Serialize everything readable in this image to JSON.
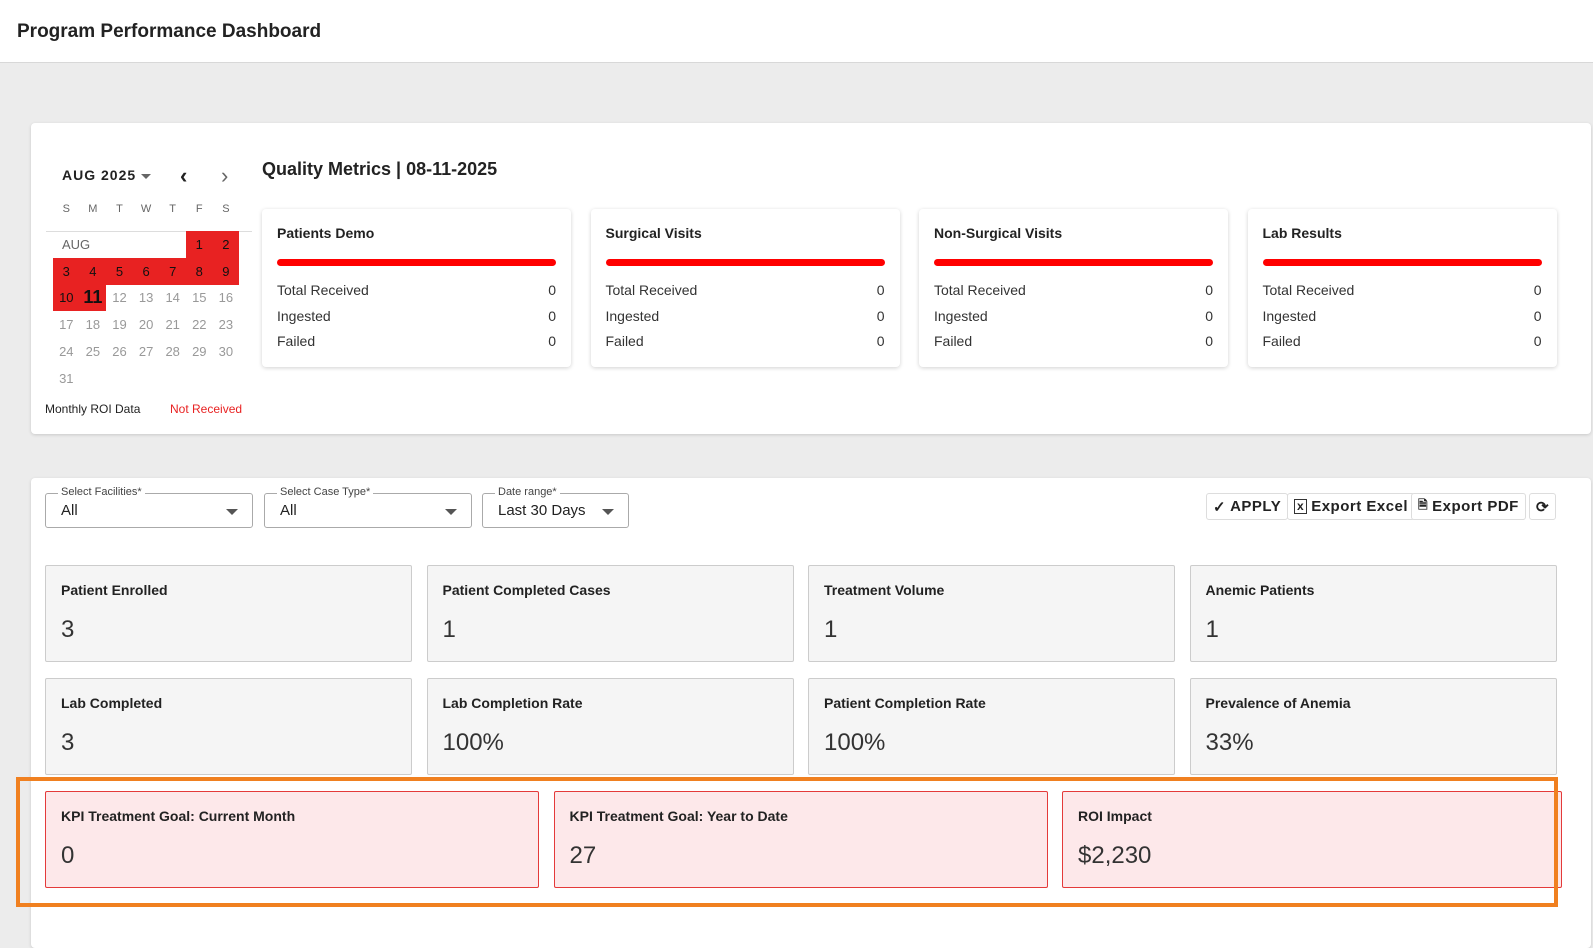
{
  "header": {
    "title": "Program Performance Dashboard"
  },
  "calendar": {
    "month_label": "AUG 2025",
    "weekdays": [
      "S",
      "M",
      "T",
      "W",
      "T",
      "F",
      "S"
    ],
    "section_label": "AUG",
    "days": [
      "1",
      "2",
      "3",
      "4",
      "5",
      "6",
      "7",
      "8",
      "9",
      "10",
      "11",
      "12",
      "13",
      "14",
      "15",
      "16",
      "17",
      "18",
      "19",
      "20",
      "21",
      "22",
      "23",
      "24",
      "25",
      "26",
      "27",
      "28",
      "29",
      "30",
      "31"
    ],
    "highlighted_through": 11,
    "today": "11",
    "legend_label": "Monthly ROI Data",
    "legend_status": "Not Received",
    "highlight_color": "#e82222"
  },
  "quality": {
    "title": "Quality Metrics | 08-11-2025",
    "cards": [
      {
        "title": "Patients Demo",
        "rows": [
          [
            "Total Received",
            "0"
          ],
          [
            "Ingested",
            "0"
          ],
          [
            "Failed",
            "0"
          ]
        ]
      },
      {
        "title": "Surgical Visits",
        "rows": [
          [
            "Total Received",
            "0"
          ],
          [
            "Ingested",
            "0"
          ],
          [
            "Failed",
            "0"
          ]
        ]
      },
      {
        "title": "Non-Surgical Visits",
        "rows": [
          [
            "Total Received",
            "0"
          ],
          [
            "Ingested",
            "0"
          ],
          [
            "Failed",
            "0"
          ]
        ]
      },
      {
        "title": "Lab Results",
        "rows": [
          [
            "Total Received",
            "0"
          ],
          [
            "Ingested",
            "0"
          ],
          [
            "Failed",
            "0"
          ]
        ]
      }
    ]
  },
  "filters": {
    "facilities": {
      "label": "Select Facilities*",
      "value": "All"
    },
    "case_type": {
      "label": "Select Case Type*",
      "value": "All"
    },
    "date_range": {
      "label": "Date range*",
      "value": "Last 30 Days"
    }
  },
  "toolbar": {
    "apply": "APPLY",
    "export_excel": "Export Excel",
    "export_pdf": "Export PDF"
  },
  "kpis": [
    {
      "title": "Patient Enrolled",
      "value": "3"
    },
    {
      "title": "Patient Completed Cases",
      "value": "1"
    },
    {
      "title": "Treatment Volume",
      "value": "1"
    },
    {
      "title": "Anemic Patients",
      "value": "1"
    },
    {
      "title": "Lab Completed",
      "value": "3"
    },
    {
      "title": "Lab Completion Rate",
      "value": "100%"
    },
    {
      "title": "Patient Completion Rate",
      "value": "100%"
    },
    {
      "title": "Prevalence of Anemia",
      "value": "33%"
    }
  ],
  "goals": [
    {
      "title": "KPI Treatment Goal: Current Month",
      "value": "0"
    },
    {
      "title": "KPI Treatment Goal: Year to Date",
      "value": "27"
    },
    {
      "title": "ROI Impact",
      "value": "$2,230"
    }
  ]
}
